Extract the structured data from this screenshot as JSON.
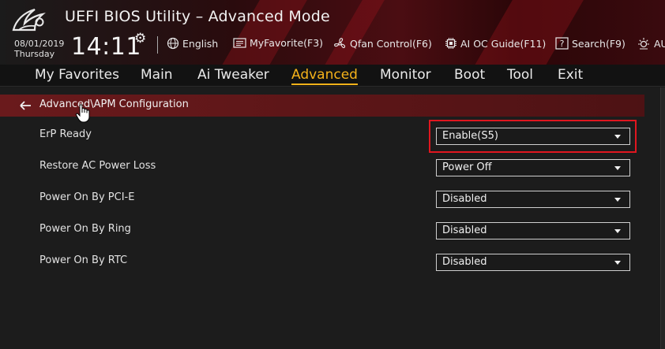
{
  "header": {
    "title": "UEFI BIOS Utility – Advanced Mode",
    "date": "08/01/2019",
    "day": "Thursday",
    "time": "14:11",
    "tools": [
      {
        "label": "English",
        "icon": "globe-icon"
      },
      {
        "label": "MyFavorite(F3)",
        "icon": "favorite-list-icon"
      },
      {
        "label": "Qfan Control(F6)",
        "icon": "fan-icon"
      },
      {
        "label": "AI OC Guide(F11)",
        "icon": "chip-icon"
      },
      {
        "label": "Search(F9)",
        "icon": "help-question-icon"
      },
      {
        "label": "AU",
        "icon": "aura-light-icon"
      }
    ]
  },
  "nav": {
    "items": [
      {
        "label": "My Favorites"
      },
      {
        "label": "Main"
      },
      {
        "label": "Ai Tweaker"
      },
      {
        "label": "Advanced",
        "active": true
      },
      {
        "label": "Monitor"
      },
      {
        "label": "Boot"
      },
      {
        "label": "Tool"
      },
      {
        "label": "Exit"
      }
    ]
  },
  "breadcrumb": {
    "text": "Advanced\\APM Configuration"
  },
  "settings": [
    {
      "label": "ErP Ready",
      "value": "Enable(S5)",
      "highlighted": true
    },
    {
      "label": "Restore AC Power Loss",
      "value": "Power Off"
    },
    {
      "label": "Power On By PCI-E",
      "value": "Disabled"
    },
    {
      "label": "Power On By Ring",
      "value": "Disabled"
    },
    {
      "label": "Power On By RTC",
      "value": "Disabled"
    }
  ],
  "colors": {
    "accent_active": "#f5b21a",
    "highlight_border": "#e0161f",
    "breadcrumb_bg": "#6a1a1c"
  }
}
